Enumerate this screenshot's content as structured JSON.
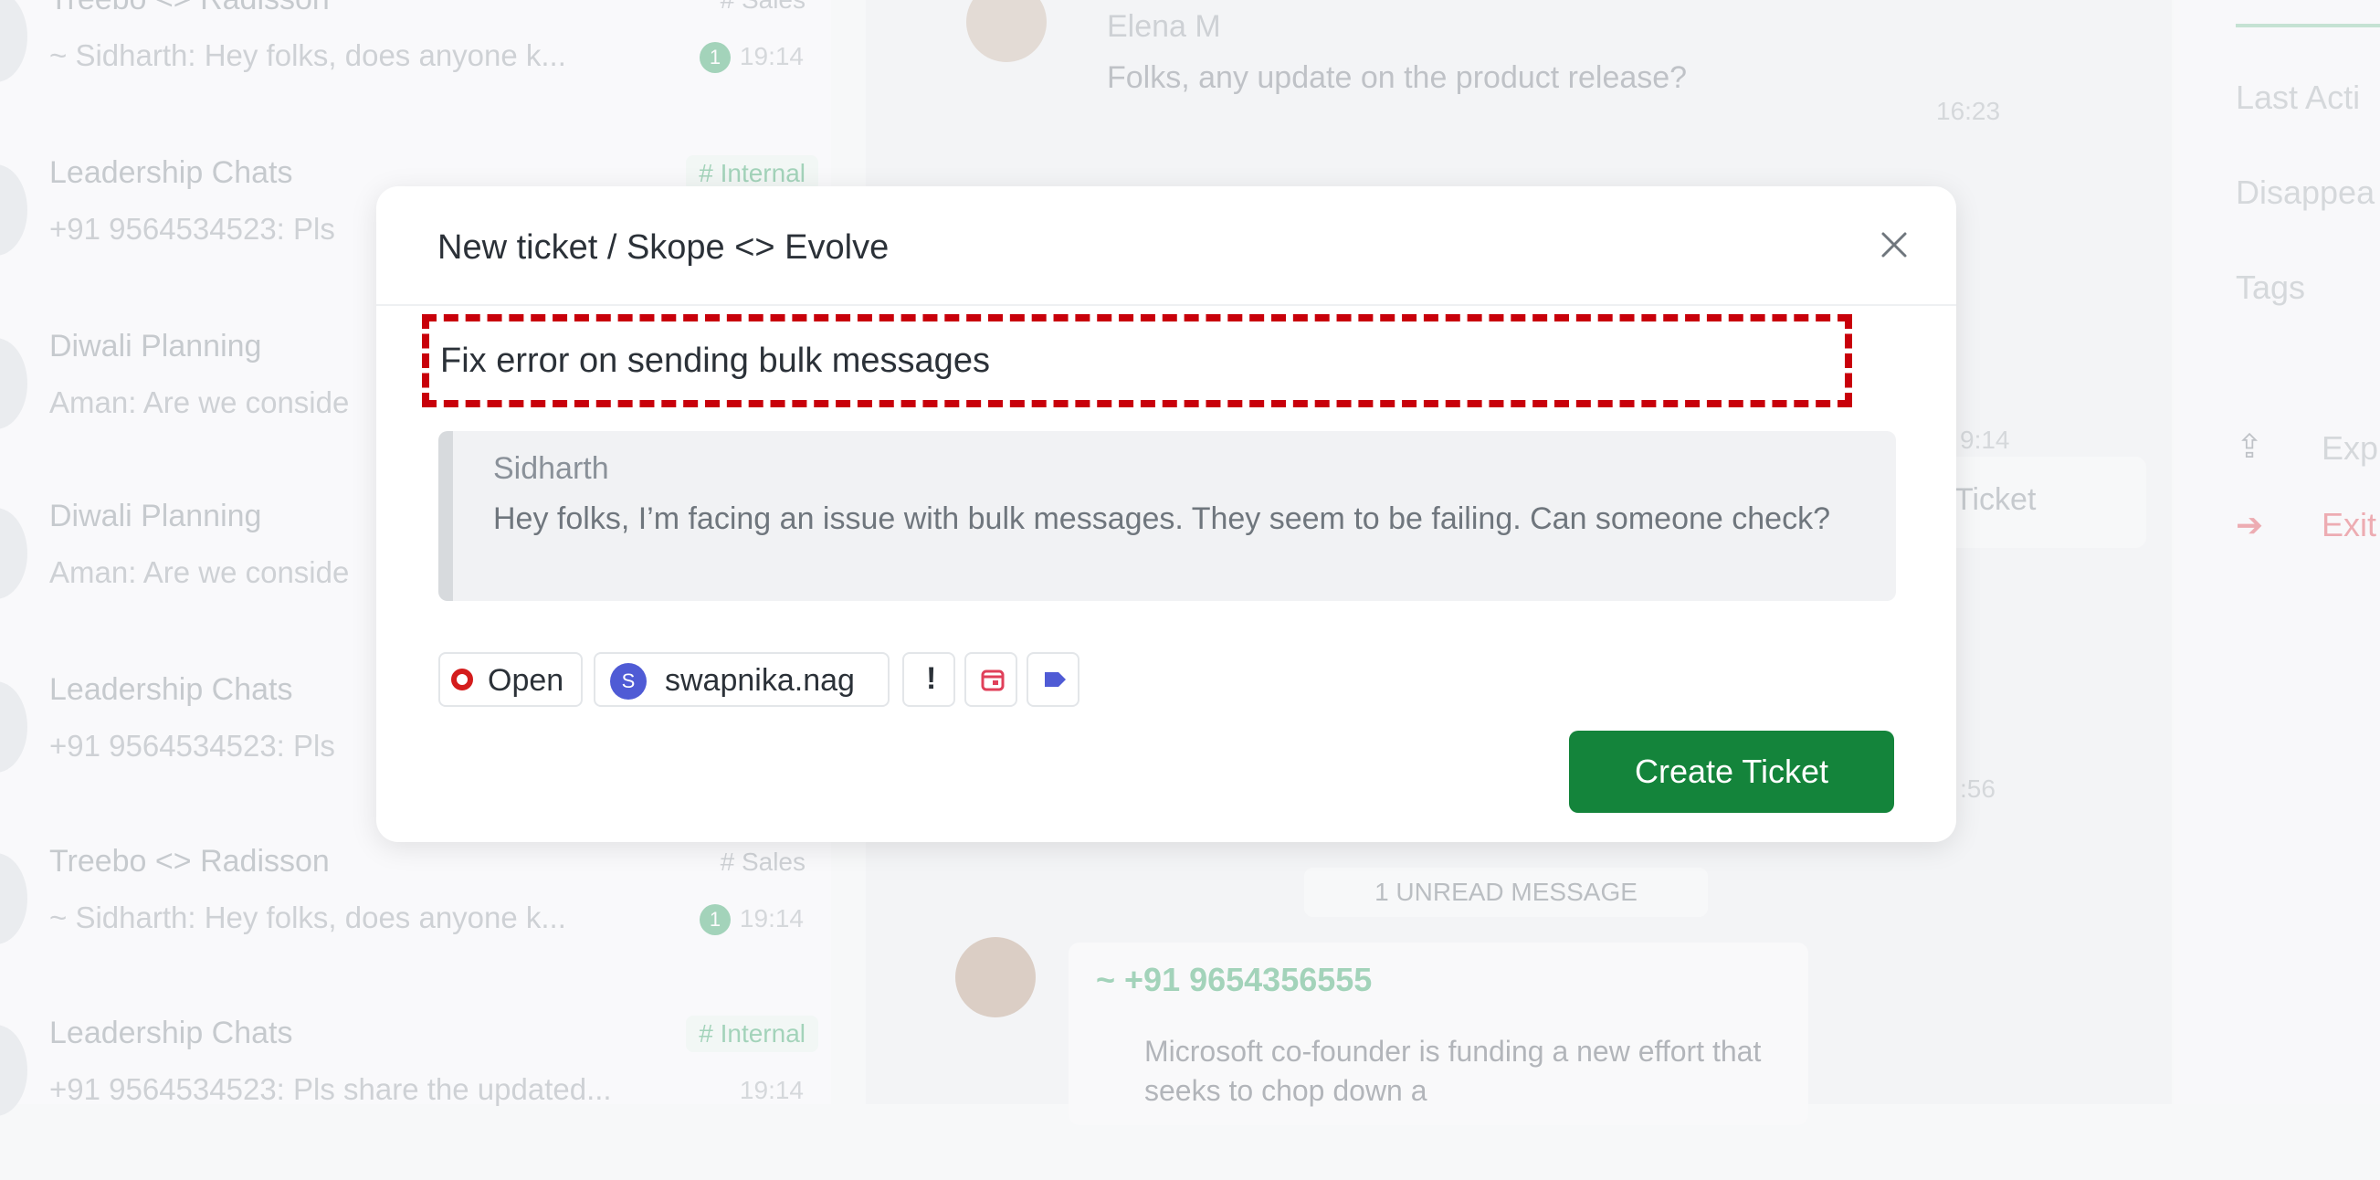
{
  "sidebar": {
    "chats": [
      {
        "title": "Treebo <> Radisson",
        "preview": "~ Sidharth: Hey folks, does anyone k...",
        "tag": "# Sales",
        "unread": "1",
        "time": "19:14"
      },
      {
        "title": "Leadership Chats",
        "preview": "+91 9564534523: Pls",
        "tag": "# Internal",
        "time": ""
      },
      {
        "title": "Diwali Planning",
        "preview": "Aman: Are we conside",
        "tag": "",
        "time": ""
      },
      {
        "title": "Diwali Planning",
        "preview": "Aman: Are we conside",
        "tag": "",
        "time": ""
      },
      {
        "title": "Leadership Chats",
        "preview": "+91 9564534523: Pls",
        "tag": "",
        "time": ""
      },
      {
        "title": "Treebo <> Radisson",
        "preview": "~ Sidharth: Hey folks, does anyone k...",
        "tag": "# Sales",
        "unread": "1",
        "time": "19:14"
      },
      {
        "title": "Leadership Chats",
        "preview": "+91 9564534523: Pls share the updated...",
        "tag": "# Internal",
        "time": "19:14"
      }
    ]
  },
  "chat": {
    "messages": [
      {
        "name": "Elena M",
        "text": "Folks, any update on the product release?",
        "time": "16:23"
      }
    ],
    "partial_time_1": "9:14",
    "partial_time_2": ":56",
    "ticket_chip_label": "Ticket",
    "unread_label": "1 UNREAD MESSAGE",
    "forward": {
      "sender": "~ +91 9654356555",
      "text": "Microsoft co-founder is funding a new effort that seeks to chop down a"
    }
  },
  "right_panel": {
    "items": [
      "Last Acti",
      "Disappea",
      "Tags"
    ],
    "export_label": "Exp",
    "exit_label": "Exit"
  },
  "modal": {
    "title": "New ticket / Skope <> Evolve",
    "ticket_title_value": "Fix error on sending bulk messages",
    "quote": {
      "author": "Sidharth",
      "text": "Hey folks, I’m facing an issue with bulk messages. They seem to be failing. Can someone check?"
    },
    "status": {
      "label": "Open",
      "color": "#d41c1c"
    },
    "assignee": {
      "initial": "S",
      "name": "swapnika.nag",
      "color": "#4f5bd5"
    },
    "priority_symbol": "!",
    "icons": [
      "priority-icon",
      "calendar-icon",
      "label-icon"
    ],
    "create_button_label": "Create Ticket",
    "accent_color": "#14843b",
    "highlight_color": "#c8000a"
  }
}
